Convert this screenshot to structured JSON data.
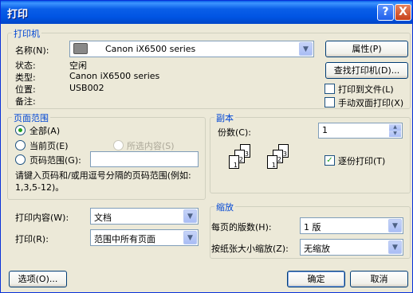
{
  "window": {
    "title": "打印",
    "help": "?",
    "close": "X"
  },
  "printer": {
    "group_label": "打印机",
    "name_label": "名称(N):",
    "name_value": "Canon iX6500 series",
    "properties_button": "属性(P)",
    "find_button": "查找打印机(D)...",
    "status_label": "状态:",
    "status_value": "空闲",
    "type_label": "类型:",
    "type_value": "Canon iX6500 series",
    "location_label": "位置:",
    "location_value": "USB002",
    "comment_label": "备注:",
    "print_to_file": "打印到文件(L)",
    "manual_duplex": "手动双面打印(X)"
  },
  "range": {
    "group_label": "页面范围",
    "all": "全部(A)",
    "current": "当前页(E)",
    "selection": "所选内容(S)",
    "pages": "页码范围(G):",
    "hint": "请键入页码和/或用逗号分隔的页码范围(例如: 1,3,5-12)。"
  },
  "copies": {
    "group_label": "副本",
    "count_label": "份数(C):",
    "count_value": "1",
    "collate": "逐份打印(T)",
    "page_labels": [
      "1",
      "2",
      "3"
    ]
  },
  "content": {
    "what_label": "打印内容(W):",
    "what_value": "文档",
    "print_label": "打印(R):",
    "print_value": "范围中所有页面"
  },
  "zoom": {
    "group_label": "缩放",
    "pps_label": "每页的版数(H):",
    "pps_value": "1 版",
    "scale_label": "按纸张大小缩放(Z):",
    "scale_value": "无缩放"
  },
  "footer": {
    "options": "选项(O)...",
    "ok": "确定",
    "cancel": "取消"
  }
}
